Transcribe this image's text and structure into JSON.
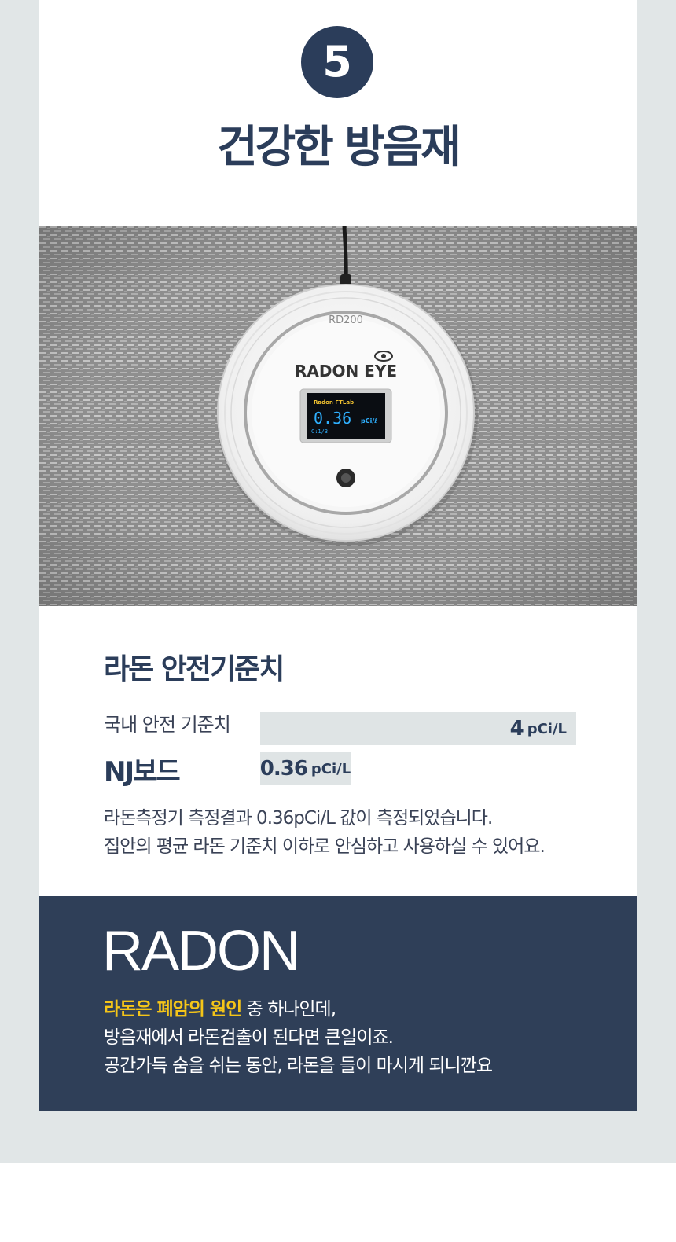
{
  "colors": {
    "navy": "#2b3d5a",
    "dark_panel": "#2f3f58",
    "highlight_yellow": "#f5c518",
    "bar_gray": "#dfe4e5",
    "outer_background": "#e1e6e7"
  },
  "header": {
    "step_number": "5",
    "title": "건강한 방음재"
  },
  "photo": {
    "device_model": "RD200",
    "device_brand": "RADON EYE",
    "screen_brand": "Radon FTLab",
    "screen_value": "0.36",
    "screen_unit": "pCi/ℓ",
    "screen_status": "C:1/3"
  },
  "safety": {
    "title": "라돈 안전기준치",
    "rows": [
      {
        "label": "국내 안전 기준치",
        "value": "4",
        "unit": "pCi/L"
      },
      {
        "label": "NJ보드",
        "value": "0.36",
        "unit": "pCi/L"
      }
    ],
    "description": [
      "라돈측정기 측정결과 0.36pCi/L 값이 측정되었습니다.",
      "집안의 평균 라돈 기준치 이하로 안심하고 사용하실 수 있어요."
    ]
  },
  "radon_section": {
    "heading": "RADON",
    "highlight": "라돈은 폐암의 원인",
    "line1_rest": " 중 하나인데,",
    "line2": "방음재에서 라돈검출이 된다면 큰일이죠.",
    "line3": "공간가득 숨을 쉬는 동안, 라돈을 들이 마시게 되니깐요"
  }
}
